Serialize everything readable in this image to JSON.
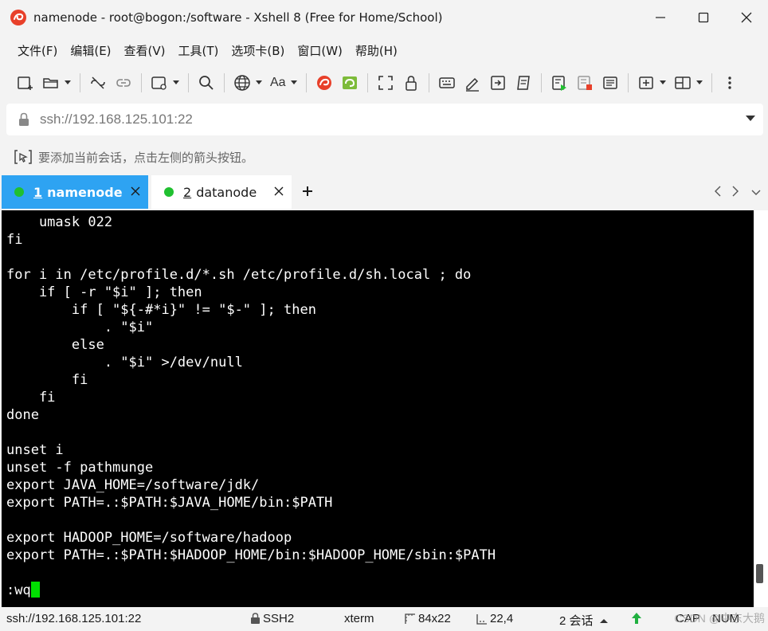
{
  "window": {
    "title": "namenode - root@bogon:/software - Xshell 8 (Free for Home/School)"
  },
  "menu": [
    "文件(F)",
    "编辑(E)",
    "查看(V)",
    "工具(T)",
    "选项卡(B)",
    "窗口(W)",
    "帮助(H)"
  ],
  "toolbar": {
    "font_label": "Aa",
    "icons": [
      "new-session-icon",
      "open-folder-icon",
      "disconnect-icon",
      "reconnect-icon",
      "new-tab-icon",
      "search-icon",
      "globe-icon",
      "font-icon",
      "xshell-icon",
      "xftp-icon",
      "fullscreen-icon",
      "lock-icon",
      "keyboard-icon",
      "pen-icon",
      "enter-icon",
      "script-icon",
      "run-script-icon",
      "log-icon",
      "document-icon",
      "add-pane-icon",
      "split-layout-icon",
      "more-icon"
    ]
  },
  "address": {
    "value": "ssh://192.168.125.101:22"
  },
  "hint": {
    "text": "要添加当前会话，点击左侧的箭头按钮。"
  },
  "tabs": [
    {
      "number": "1",
      "label": "namenode",
      "active": true,
      "status_color": "#20c030"
    },
    {
      "number": "2",
      "label": "datanode",
      "active": false,
      "status_color": "#20c030"
    }
  ],
  "terminal": {
    "lines": [
      "    umask 022",
      "fi",
      "",
      "for i in /etc/profile.d/*.sh /etc/profile.d/sh.local ; do",
      "    if [ -r \"$i\" ]; then",
      "        if [ \"${-#*i}\" != \"$-\" ]; then",
      "            . \"$i\"",
      "        else",
      "            . \"$i\" >/dev/null",
      "        fi",
      "    fi",
      "done",
      "",
      "unset i",
      "unset -f pathmunge",
      "export JAVA_HOME=/software/jdk/",
      "export PATH=.:$PATH:$JAVA_HOME/bin:$PATH",
      "",
      "export HADOOP_HOME=/software/hadoop",
      "export PATH=.:$PATH:$HADOOP_HOME/bin:$HADOOP_HOME/sbin:$PATH",
      "",
      ":wq"
    ],
    "background": "#000000",
    "foreground": "#ffffff",
    "cursor_color": "#00e000"
  },
  "status": {
    "connection": "ssh://192.168.125.101:22",
    "protocol": "SSH2",
    "term_type": "xterm",
    "size": "84x22",
    "cursor_pos": "22,4",
    "sessions": "2 会话",
    "caps": "CAP",
    "num": "NUM",
    "watermark": "CSDN @中东大鹅"
  },
  "colors": {
    "active_tab": "#2ea3f2",
    "brand_red": "#e8402a",
    "xftp_green": "#7dbb3a"
  }
}
